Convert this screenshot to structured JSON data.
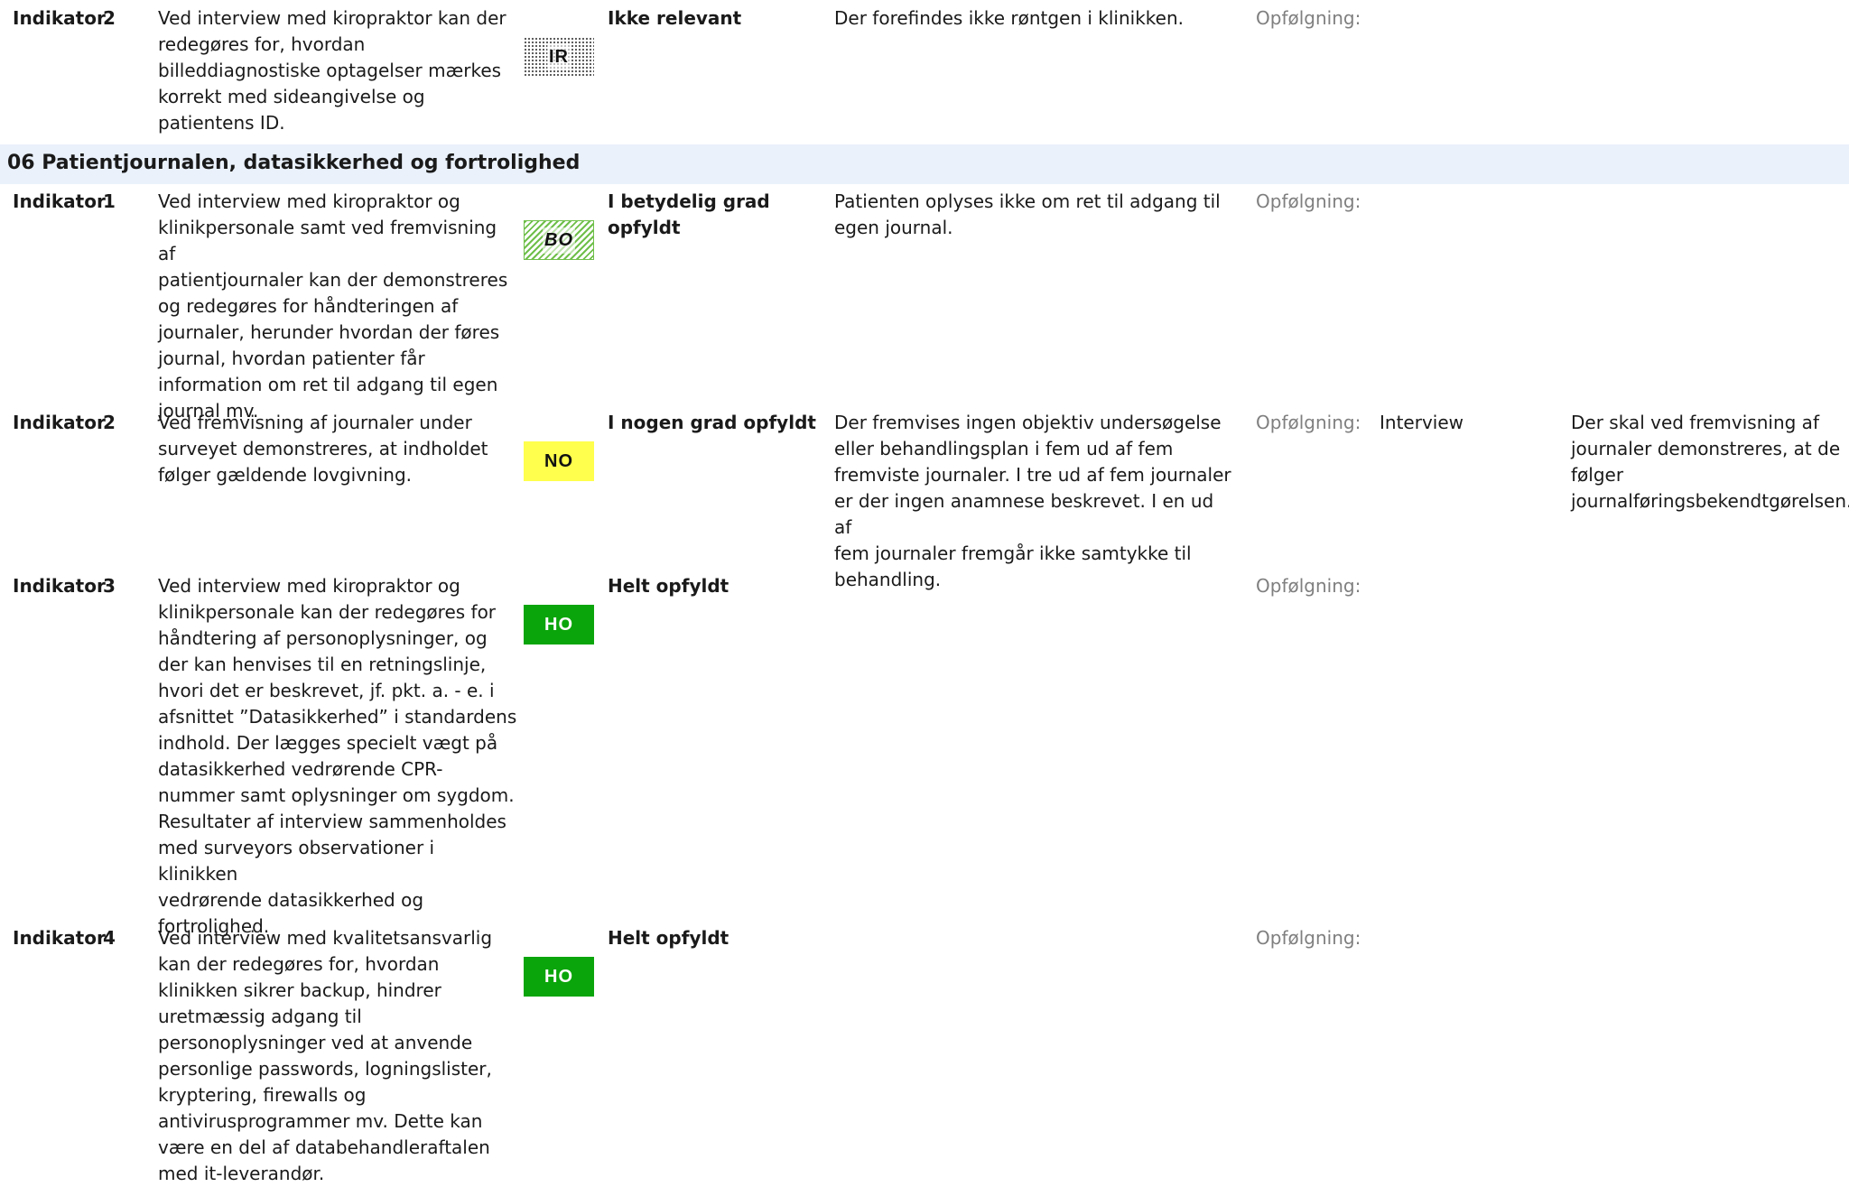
{
  "rows_top": [
    {
      "indicator_label": "Indikator",
      "number": "2",
      "description": "Ved interview med kiropraktor kan der\nredegøres for, hvordan\nbilleddiagnostiske optagelser mærkes\nkorrekt med sideangivelse og\npatientens ID.",
      "badge": "IR",
      "status": "Ikke relevant",
      "finding": "Der forefindes ikke røntgen i klinikken.",
      "follow_up_label": "Opfølgning:",
      "method": "",
      "requirement": ""
    }
  ],
  "section": {
    "title": "06 Patientjournalen, datasikkerhed og fortrolighed"
  },
  "rows": [
    {
      "indicator_label": "Indikator",
      "number": "1",
      "description": "Ved interview med kiropraktor og\nklinikpersonale samt ved fremvisning af\npatientjournaler kan der demonstreres\nog redegøres for håndteringen af\njournaler, herunder hvordan der føres\njournal, hvordan patienter får\ninformation om ret til adgang til egen\njournal mv.",
      "badge": "BO",
      "status": "I betydelig grad opfyldt",
      "finding": "Patienten oplyses ikke om ret til adgang til\negen journal.",
      "follow_up_label": "Opfølgning:",
      "method": "",
      "requirement": ""
    },
    {
      "indicator_label": "Indikator",
      "number": "2",
      "description": "Ved fremvisning af journaler under\nsurveyet demonstreres, at indholdet\nfølger gældende lovgivning.",
      "badge": "NO",
      "status": "I nogen grad opfyldt",
      "finding": "Der fremvises ingen objektiv undersøgelse\neller behandlingsplan i fem ud af fem\nfremviste journaler. I tre ud af fem journaler\ner der ingen anamnese beskrevet. I en ud af\nfem journaler fremgår ikke samtykke til\nbehandling.",
      "follow_up_label": "Opfølgning:",
      "method": "Interview",
      "requirement": "Der skal ved fremvisning af\njournaler demonstreres, at de\nfølger\njournalføringsbekendtgørelsen."
    },
    {
      "indicator_label": "Indikator",
      "number": "3",
      "description": "Ved interview med kiropraktor og\nklinikpersonale kan der redegøres for\nhåndtering af personoplysninger, og\nder kan henvises til en retningslinje,\nhvori det er beskrevet, jf. pkt. a. - e. i\nafsnittet ”Datasikkerhed” i standardens\nindhold.   Der lægges specielt vægt på\ndatasikkerhed vedrørende CPR-\nnummer samt oplysninger om sygdom.\nResultater af interview sammenholdes\nmed surveyors observationer i klinikken\nvedrørende datasikkerhed og\nfortrolighed.",
      "badge": "HO",
      "status": "Helt opfyldt",
      "finding": "",
      "follow_up_label": "Opfølgning:",
      "method": "",
      "requirement": ""
    },
    {
      "indicator_label": "Indikator",
      "number": "4",
      "description": "Ved interview med kvalitetsansvarlig\nkan der redegøres for, hvordan\nklinikken sikrer backup, hindrer\nuretmæssig adgang til\npersonoplysninger ved at anvende\npersonlige passwords, logningslister,\nkryptering, firewalls og\nantivirusprogrammer mv.   Dette kan\nvære en del af databehandleraftalen\nmed it-leverandør.",
      "badge": "HO",
      "status": "Helt opfyldt",
      "finding": "",
      "follow_up_label": "Opfølgning:",
      "method": "",
      "requirement": ""
    }
  ],
  "colors": {
    "section_bg": "#eaf1fb",
    "badge_ho": "#0aa50a",
    "badge_no": "#ffff4d",
    "badge_bo": "#6fbf4a",
    "follow_up_text": "#7f7f7f"
  },
  "icons": {
    "IR": "dotted-pattern-badge-icon",
    "BO": "hatched-green-badge-icon",
    "NO": "yellow-badge-icon",
    "HO": "solid-green-badge-icon"
  }
}
